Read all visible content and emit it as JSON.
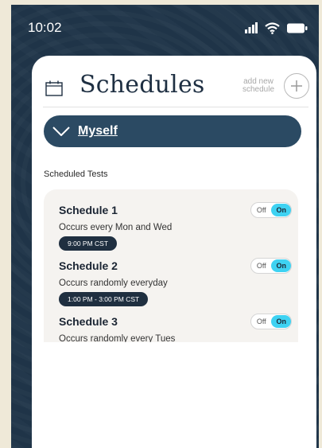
{
  "status_bar": {
    "time": "10:02",
    "icons": [
      "signal-icon",
      "wifi-icon",
      "battery-icon"
    ]
  },
  "header": {
    "icon": "calendar-icon",
    "title": "Schedules",
    "add_label_line1": "add new",
    "add_label_line2": "schedule",
    "add_icon": "plus-circle-icon"
  },
  "person_selector": {
    "icon": "chevron-down-icon",
    "name": "Myself"
  },
  "section": {
    "label": "Scheduled Tests"
  },
  "schedules": [
    {
      "name": "Schedule 1",
      "description": "Occurs every Mon and Wed",
      "time": "9:00 PM CST",
      "toggle_off": "Off",
      "toggle_on": "On",
      "state": "on"
    },
    {
      "name": "Schedule 2",
      "description": "Occurs randomly everyday",
      "time": "1:00 PM - 3:00 PM CST",
      "toggle_off": "Off",
      "toggle_on": "On",
      "state": "on"
    },
    {
      "name": "Schedule 3",
      "description": "Occurs randomly every Tues",
      "time": "",
      "toggle_off": "Off",
      "toggle_on": "On",
      "state": "on"
    }
  ],
  "colors": {
    "navy": "#1f3448",
    "pill": "#2b4a63",
    "toggle_on": "#3ed2f2",
    "card": "#f5f3f0",
    "frame": "#efe9d8"
  }
}
